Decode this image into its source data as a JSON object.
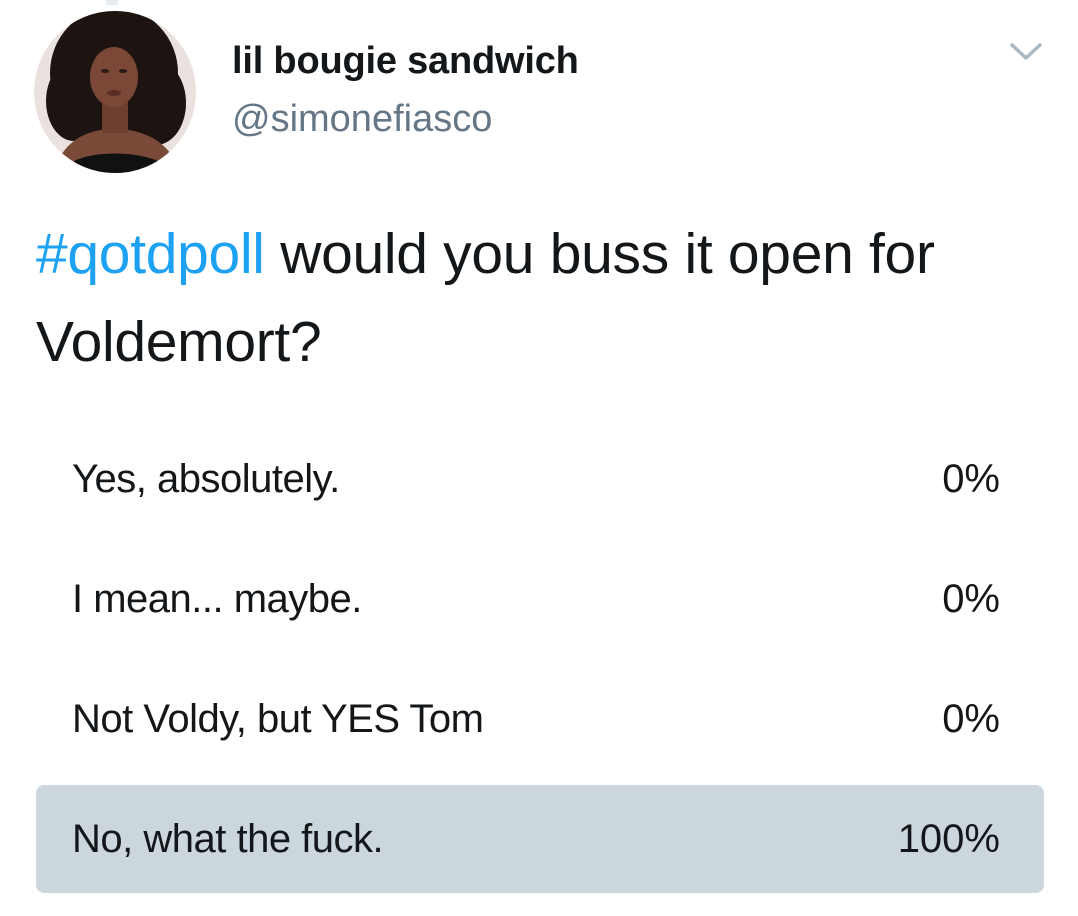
{
  "tweet": {
    "display_name": "lil bougie sandwich",
    "handle": "@simonefiasco",
    "hashtag": "#qotdpoll",
    "text": " would you buss it open for Voldemort?"
  },
  "icons": {
    "avatar": "user-avatar-photo",
    "caret": "chevron-down-icon"
  },
  "colors": {
    "hashtag": "#1da1f2",
    "handle": "#657786",
    "poll_winner_fill": "#ccd6dd",
    "text": "#14171a"
  },
  "poll": {
    "options": [
      {
        "label": "Yes, absolutely.",
        "percent_label": "0%",
        "fraction": 0.0
      },
      {
        "label": "I mean... maybe.",
        "percent_label": "0%",
        "fraction": 0.0
      },
      {
        "label": "Not Voldy, but YES Tom",
        "percent_label": "0%",
        "fraction": 0.0
      },
      {
        "label": "No, what the fuck.",
        "percent_label": "100%",
        "fraction": 1.0
      }
    ]
  }
}
